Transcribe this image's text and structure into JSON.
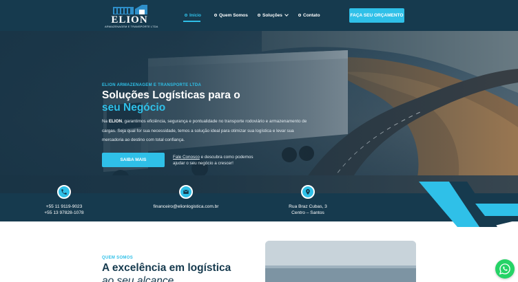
{
  "brand": {
    "name": "ELION",
    "tagline": "ARMAZENAGEM E TRANSPORTE LTDA"
  },
  "nav": {
    "items": [
      {
        "label": "Início",
        "active": true
      },
      {
        "label": "Quem Somos",
        "active": false
      },
      {
        "label": "Soluções",
        "active": false,
        "dropdown": true
      },
      {
        "label": "Contato",
        "active": false
      }
    ],
    "cta_label": "FAÇA SEU ORÇAMENTO"
  },
  "hero": {
    "eyebrow": "ELION ARMAZENAGEM E TRANSPORTE LTDA",
    "title_line1": "Soluções Logísticas para o",
    "title_line2": "seu Negócio",
    "desc_brand": "ELION",
    "desc_prefix": "Na",
    "desc_rest": ", garantimos eficiência, segurança e pontualidade no transporte rodoviário e armazenamento de cargas. Seja qual for sua necessidade, temos a solução ideal para otimizar sua logística e levar sua mercadoria ao destino com total confiança.",
    "button_label": "SAIBA MAIS",
    "link_label": "Fale Conosco",
    "link_rest": " e descubra como podemos ajudar o seu negócio a crescer!"
  },
  "contact": {
    "phone_1": "+55 11 9119-9023",
    "phone_2": "+55 13 97828-1078",
    "email": "financeiro@elionlogistica.com.br",
    "address_1": "Rua Braz Cubas, 3",
    "address_2": "Centro – Santos",
    "icons": [
      "phone-icon",
      "mail-icon",
      "location-pin-icon"
    ]
  },
  "about": {
    "eyebrow": "QUEM SOMOS",
    "title_line1": "A excelência em logística",
    "title_line2": "ao seu alcance"
  },
  "colors": {
    "navy": "#163a4e",
    "accent": "#2fc0e8",
    "whatsapp": "#25d366"
  }
}
